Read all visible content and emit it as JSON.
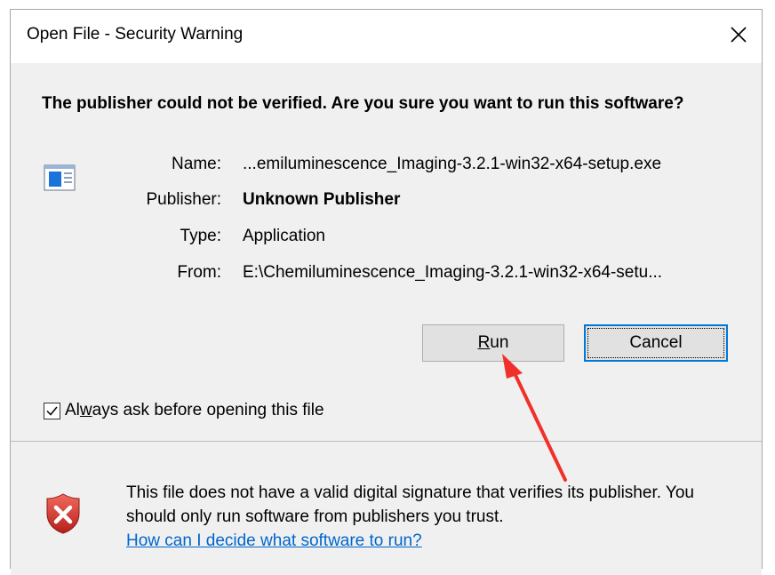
{
  "window": {
    "title": "Open File - Security Warning",
    "close_glyph": "✕"
  },
  "question": "The publisher could not be verified.  Are you sure you want to run this software?",
  "details": {
    "name_label": "Name:",
    "name_value": "...emiluminescence_Imaging-3.2.1-win32-x64-setup.exe",
    "publisher_label": "Publisher:",
    "publisher_value": "Unknown Publisher",
    "type_label": "Type:",
    "type_value": "Application",
    "from_label": "From:",
    "from_value": "E:\\Chemiluminescence_Imaging-3.2.1-win32-x64-setu..."
  },
  "buttons": {
    "run_mnemonic": "R",
    "run_rest": "un",
    "cancel": "Cancel"
  },
  "checkbox": {
    "checked": true,
    "label_pre": "Al",
    "label_mnemonic": "w",
    "label_post": "ays ask before opening this file"
  },
  "warning": {
    "text": "This file does not have a valid digital signature that verifies its publisher.  You should only run software from publishers you trust.",
    "link": "How can I decide what software to run?"
  },
  "colors": {
    "accent": "#0078d7",
    "annotation_arrow": "#f0312a",
    "shield": "#d9332b"
  },
  "icons": {
    "app": "application-icon",
    "shield": "security-shield-icon",
    "close": "close-icon"
  }
}
